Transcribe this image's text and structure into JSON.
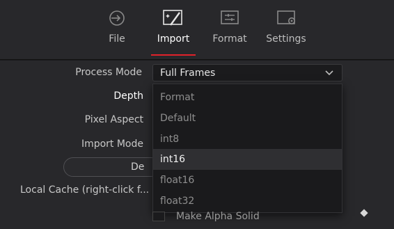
{
  "tabs": [
    {
      "label": "File",
      "icon": "file-import-icon"
    },
    {
      "label": "Import",
      "icon": "magic-wand-icon",
      "active": true
    },
    {
      "label": "Format",
      "icon": "sliders-icon"
    },
    {
      "label": "Settings",
      "icon": "gear-icon"
    }
  ],
  "colors": {
    "accent": "#e2212a",
    "panel": "#28282b",
    "field": "#1b1b1d"
  },
  "form": {
    "process_mode_label": "Process Mode",
    "process_mode_value": "Full Frames",
    "depth_label": "Depth",
    "pixel_aspect_label": "Pixel Aspect",
    "import_mode_label": "Import Mode",
    "pill_text": "De",
    "local_cache_label": "Local Cache (right-click f...",
    "make_alpha_label": "Make Alpha Solid"
  },
  "dropdown": {
    "options": [
      "Format",
      "Default",
      "int8",
      "int16",
      "float16",
      "float32"
    ],
    "highlighted": "int16"
  }
}
